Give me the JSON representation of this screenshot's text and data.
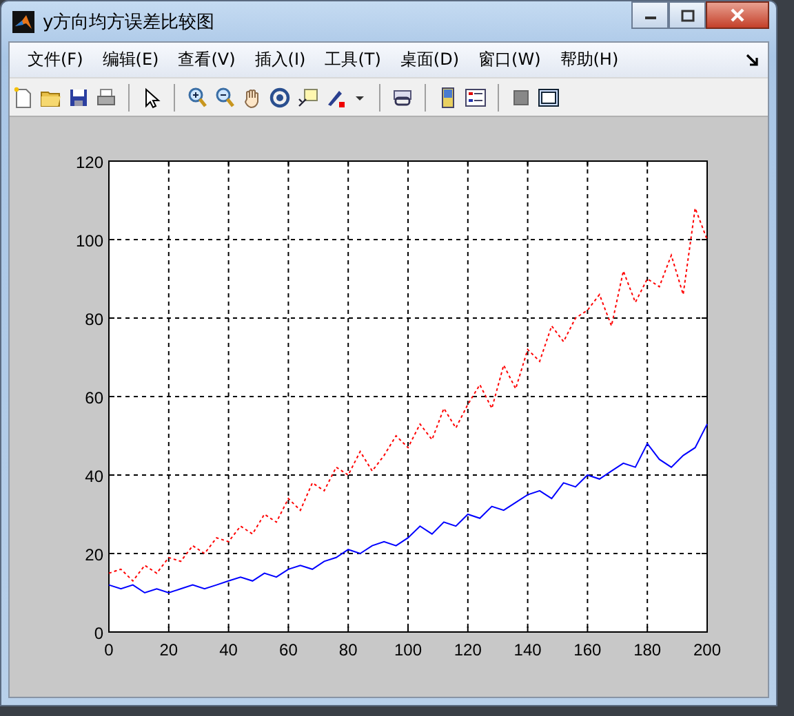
{
  "window": {
    "title": "y方向均方误差比较图"
  },
  "menu": [
    "文件(F)",
    "编辑(E)",
    "查看(V)",
    "插入(I)",
    "工具(T)",
    "桌面(D)",
    "窗口(W)",
    "帮助(H)"
  ],
  "figure": {
    "chart_data": {
      "type": "line",
      "x": [
        0,
        4,
        8,
        12,
        16,
        20,
        24,
        28,
        32,
        36,
        40,
        44,
        48,
        52,
        56,
        60,
        64,
        68,
        72,
        76,
        80,
        84,
        88,
        92,
        96,
        100,
        104,
        108,
        112,
        116,
        120,
        124,
        128,
        132,
        136,
        140,
        144,
        148,
        152,
        156,
        160,
        164,
        168,
        172,
        176,
        180,
        184,
        188,
        192,
        196,
        200
      ],
      "xlim": [
        0,
        200
      ],
      "ylim": [
        0,
        120
      ],
      "grid": true,
      "xticks": [
        0,
        20,
        40,
        60,
        80,
        100,
        120,
        140,
        160,
        180,
        200
      ],
      "yticks": [
        0,
        20,
        40,
        60,
        80,
        100,
        120
      ],
      "series": [
        {
          "color": "#0000ff",
          "line_style": "solid",
          "values": [
            12,
            11,
            12,
            10,
            11,
            10,
            11,
            12,
            11,
            12,
            13,
            14,
            13,
            15,
            14,
            16,
            17,
            16,
            18,
            19,
            21,
            20,
            22,
            23,
            22,
            24,
            27,
            25,
            28,
            27,
            30,
            29,
            32,
            31,
            33,
            35,
            36,
            34,
            38,
            37,
            40,
            39,
            41,
            43,
            42,
            48,
            44,
            42,
            45,
            47,
            53
          ]
        },
        {
          "color": "#ff0000",
          "line_style": "dotted",
          "values": [
            15,
            16,
            13,
            17,
            15,
            19,
            18,
            22,
            20,
            24,
            23,
            27,
            25,
            30,
            28,
            34,
            31,
            38,
            36,
            42,
            40,
            46,
            41,
            45,
            50,
            47,
            53,
            49,
            57,
            52,
            58,
            63,
            57,
            68,
            62,
            72,
            69,
            78,
            74,
            80,
            82,
            86,
            78,
            92,
            84,
            90,
            88,
            96,
            86,
            108,
            100
          ]
        }
      ]
    }
  }
}
